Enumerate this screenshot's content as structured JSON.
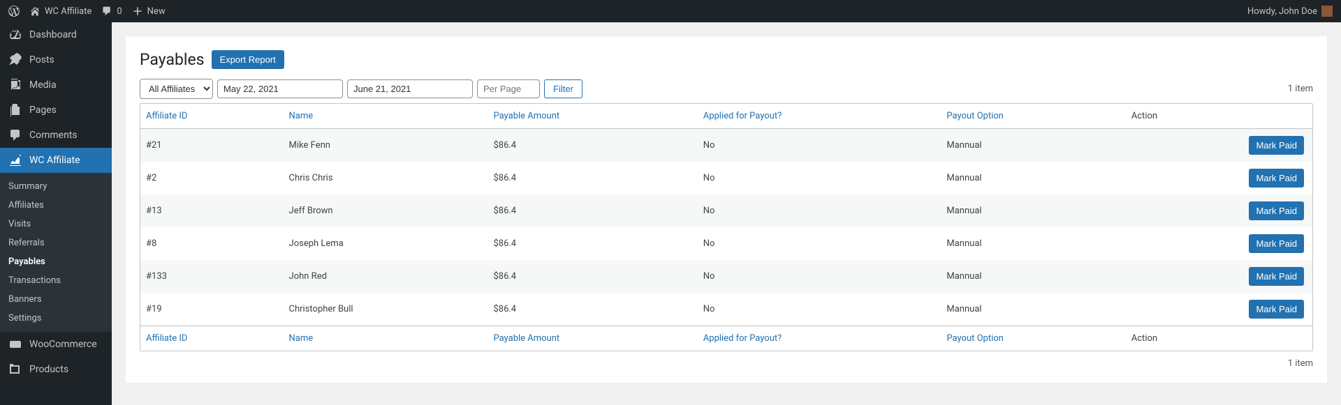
{
  "topbar": {
    "site_name": "WC Affiliate",
    "comments_count": "0",
    "new_label": "New",
    "greeting": "Howdy, John Doe"
  },
  "sidebar": {
    "items": [
      {
        "label": "Dashboard",
        "icon": "dashboard-icon"
      },
      {
        "label": "Posts",
        "icon": "pin-icon"
      },
      {
        "label": "Media",
        "icon": "media-icon"
      },
      {
        "label": "Pages",
        "icon": "page-icon"
      },
      {
        "label": "Comments",
        "icon": "comment-icon"
      },
      {
        "label": "WC Affiliate",
        "icon": "chart-icon"
      },
      {
        "label": "WooCommerce",
        "icon": "woo-icon"
      },
      {
        "label": "Products",
        "icon": "products-icon"
      }
    ],
    "submenu": [
      "Summary",
      "Affiliates",
      "Visits",
      "Referrals",
      "Payables",
      "Transactions",
      "Banners",
      "Settings"
    ]
  },
  "page": {
    "title": "Payables",
    "export_label": "Export Report",
    "affiliate_filter": "All Affiliates",
    "date_start": "May 22, 2021",
    "date_end": "June 21, 2021",
    "per_page_placeholder": "Per Page",
    "filter_label": "Filter",
    "item_count": "1 item"
  },
  "table": {
    "columns": [
      "Affiliate ID",
      "Name",
      "Payable Amount",
      "Applied for Payout?",
      "Payout Option",
      "Action"
    ],
    "mark_paid_label": "Mark Paid",
    "rows": [
      {
        "id": "#21",
        "name": "Mike Fenn",
        "amount": "$86.4",
        "applied": "No",
        "option": "Mannual"
      },
      {
        "id": "#2",
        "name": "Chris Chris",
        "amount": "$86.4",
        "applied": "No",
        "option": "Mannual"
      },
      {
        "id": "#13",
        "name": "Jeff Brown",
        "amount": "$86.4",
        "applied": "No",
        "option": "Mannual"
      },
      {
        "id": "#8",
        "name": "Joseph Lema",
        "amount": "$86.4",
        "applied": "No",
        "option": "Mannual"
      },
      {
        "id": "#133",
        "name": "John Red",
        "amount": "$86.4",
        "applied": "No",
        "option": "Mannual"
      },
      {
        "id": "#19",
        "name": "Christopher Bull",
        "amount": "$86.4",
        "applied": "No",
        "option": "Mannual"
      }
    ]
  }
}
